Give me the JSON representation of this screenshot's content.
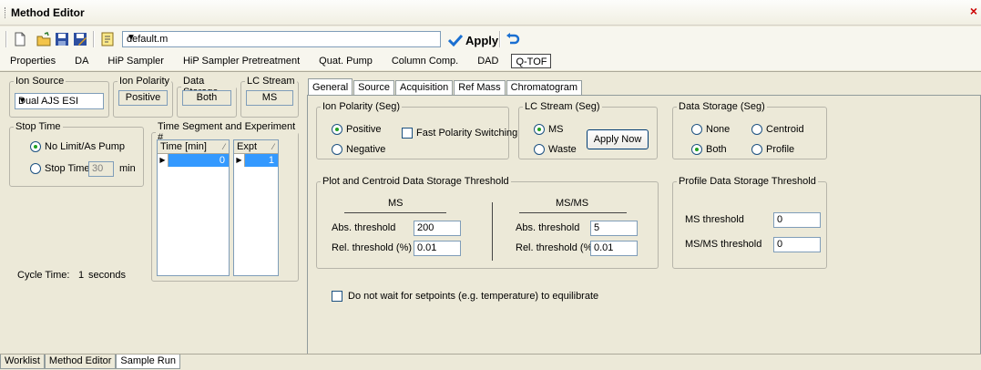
{
  "window": {
    "title": "Method Editor",
    "close_glyph": "×"
  },
  "toolbar": {
    "icons": [
      "new-file-icon",
      "open-folder-icon",
      "save-icon",
      "save-as-icon",
      "report-icon"
    ],
    "method_file": "default.m",
    "apply_label": "Apply",
    "undo_icon": "undo-icon"
  },
  "module_tabs": [
    "Properties",
    "DA",
    "HiP Sampler",
    "HiP Sampler Pretreatment",
    "Quat. Pump",
    "Column Comp.",
    "DAD",
    "Q-TOF"
  ],
  "module_tab_active": "Q-TOF",
  "left": {
    "ion_source": {
      "label": "Ion Source",
      "value": "Dual AJS ESI"
    },
    "ion_polarity": {
      "label": "Ion Polarity",
      "value": "Positive"
    },
    "data_storage": {
      "label": "Data Storage",
      "value": "Both"
    },
    "lc_stream": {
      "label": "LC Stream",
      "value": "MS"
    },
    "stop_time": {
      "label": "Stop Time",
      "option_nolimit": "No Limit/As Pump",
      "option_stoptime": "Stop Time",
      "value": "30",
      "unit": "min",
      "selected": "No Limit/As Pump"
    },
    "time_segment": {
      "label": "Time Segment and Experiment #",
      "col_time": "Time [min]",
      "col_expt": "Expt",
      "time_value": "0",
      "expt_value": "1"
    },
    "cycle_time": {
      "label": "Cycle Time:",
      "value": "1",
      "unit": "seconds"
    }
  },
  "inner_tabs": [
    "General",
    "Source",
    "Acquisition",
    "Ref Mass",
    "Chromatogram"
  ],
  "inner_tab_active": "General",
  "general": {
    "ion_polarity_seg": {
      "label": "Ion Polarity (Seg)",
      "positive": "Positive",
      "negative": "Negative",
      "fast_switching": "Fast Polarity Switching",
      "selected": "Positive"
    },
    "lc_stream_seg": {
      "label": "LC Stream (Seg)",
      "ms": "MS",
      "waste": "Waste",
      "apply_now": "Apply Now",
      "selected": "MS"
    },
    "data_storage_seg": {
      "label": "Data Storage (Seg)",
      "none": "None",
      "centroid": "Centroid",
      "both": "Both",
      "profile": "Profile",
      "selected": "Both"
    },
    "plot_threshold": {
      "label": "Plot and Centroid Data Storage Threshold",
      "ms_header": "MS",
      "msms_header": "MS/MS",
      "abs_label": "Abs. threshold",
      "rel_label": "Rel. threshold (%)",
      "ms_abs": "200",
      "ms_rel": "0.01",
      "msms_abs": "5",
      "msms_rel": "0.01"
    },
    "profile_threshold": {
      "label": "Profile Data Storage Threshold",
      "ms_label": "MS threshold",
      "msms_label": "MS/MS threshold",
      "ms_value": "0",
      "msms_value": "0"
    },
    "equilibrate_label": "Do not wait for setpoints (e.g. temperature) to equilibrate"
  },
  "status_tabs": [
    "Worklist",
    "Method Editor",
    "Sample Run"
  ],
  "status_tab_active": "Sample Run"
}
